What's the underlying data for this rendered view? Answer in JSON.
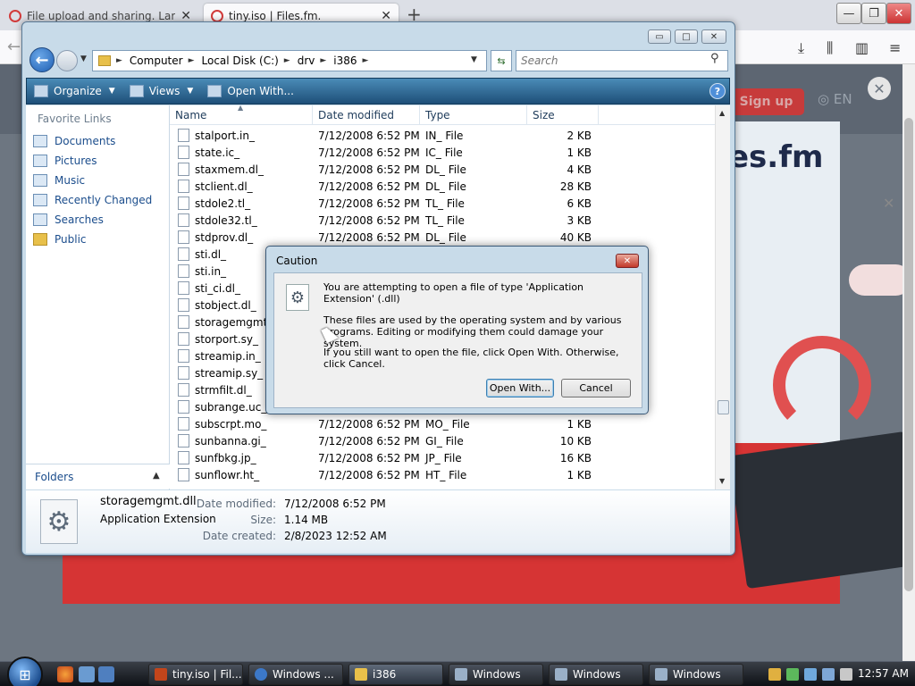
{
  "browser": {
    "tabs": [
      {
        "label": "File upload and sharing. Large"
      },
      {
        "label": "tiny.iso | Files.fm."
      }
    ],
    "new_tab": "+",
    "controls": {
      "minimize": "—",
      "maximize": "❐",
      "close": "✕"
    }
  },
  "page": {
    "signup": "Sign up",
    "lang": "EN",
    "logo_text": "es.fm",
    "modal_close": "✕"
  },
  "explorer": {
    "address": {
      "crumbs": [
        "Computer",
        "Local Disk (C:)",
        "drv",
        "i386"
      ]
    },
    "search_placeholder": "Search",
    "toolbar": {
      "organize": "Organize",
      "views": "Views",
      "open_with": "Open With...",
      "help": "?"
    },
    "favorites_title": "Favorite Links",
    "favorites": [
      "Documents",
      "Pictures",
      "Music",
      "Recently Changed",
      "Searches",
      "Public"
    ],
    "folders_label": "Folders",
    "columns": [
      "Name",
      "Date modified",
      "Type",
      "Size"
    ],
    "files": [
      {
        "name": "stalport.in_",
        "date": "7/12/2008 6:52 PM",
        "type": "IN_ File",
        "size": "2 KB"
      },
      {
        "name": "state.ic_",
        "date": "7/12/2008 6:52 PM",
        "type": "IC_ File",
        "size": "1 KB"
      },
      {
        "name": "staxmem.dl_",
        "date": "7/12/2008 6:52 PM",
        "type": "DL_ File",
        "size": "4 KB"
      },
      {
        "name": "stclient.dl_",
        "date": "7/12/2008 6:52 PM",
        "type": "DL_ File",
        "size": "28 KB"
      },
      {
        "name": "stdole2.tl_",
        "date": "7/12/2008 6:52 PM",
        "type": "TL_ File",
        "size": "6 KB"
      },
      {
        "name": "stdole32.tl_",
        "date": "7/12/2008 6:52 PM",
        "type": "TL_ File",
        "size": "3 KB"
      },
      {
        "name": "stdprov.dl_",
        "date": "7/12/2008 6:52 PM",
        "type": "DL_ File",
        "size": "40 KB"
      },
      {
        "name": "sti.dl_",
        "date": "",
        "type": "",
        "size": ""
      },
      {
        "name": "sti.in_",
        "date": "",
        "type": "",
        "size": ""
      },
      {
        "name": "sti_ci.dl_",
        "date": "",
        "type": "",
        "size": ""
      },
      {
        "name": "stobject.dl_",
        "date": "",
        "type": "",
        "size": ""
      },
      {
        "name": "storagemgmt.d",
        "date": "",
        "type": "",
        "size": ""
      },
      {
        "name": "storport.sy_",
        "date": "",
        "type": "",
        "size": ""
      },
      {
        "name": "streamip.in_",
        "date": "",
        "type": "",
        "size": ""
      },
      {
        "name": "streamip.sy_",
        "date": "",
        "type": "",
        "size": ""
      },
      {
        "name": "strmfilt.dl_",
        "date": "",
        "type": "",
        "size": ""
      },
      {
        "name": "subrange.uc_",
        "date": "",
        "type": "",
        "size": ""
      },
      {
        "name": "subscrpt.mo_",
        "date": "7/12/2008 6:52 PM",
        "type": "MO_ File",
        "size": "1 KB"
      },
      {
        "name": "sunbanna.gi_",
        "date": "7/12/2008 6:52 PM",
        "type": "GI_ File",
        "size": "10 KB"
      },
      {
        "name": "sunfbkg.jp_",
        "date": "7/12/2008 6:52 PM",
        "type": "JP_ File",
        "size": "16 KB"
      },
      {
        "name": "sunflowr.ht_",
        "date": "7/12/2008 6:52 PM",
        "type": "HT_ File",
        "size": "1 KB"
      }
    ],
    "details": {
      "name": "storagemgmt.dll",
      "type": "Application Extension",
      "date_modified_label": "Date modified:",
      "date_modified": "7/12/2008 6:52 PM",
      "size_label": "Size:",
      "size": "1.14 MB",
      "date_created_label": "Date created:",
      "date_created": "2/8/2023 12:52 AM"
    }
  },
  "dialog": {
    "title": "Caution",
    "line1": "You are attempting to open a file of type 'Application Extension' (.dll)",
    "line2": "These files are used by the operating system and by various programs. Editing or modifying them could damage your system.",
    "line3": "If you still want to open the file, click Open With. Otherwise, click Cancel.",
    "open_with": "Open With...",
    "cancel": "Cancel"
  },
  "taskbar": {
    "tasks": [
      {
        "label": "tiny.iso | Fil..."
      },
      {
        "label": "Windows ..."
      },
      {
        "label": "i386"
      },
      {
        "label": "Windows"
      },
      {
        "label": "Windows"
      },
      {
        "label": "Windows"
      }
    ],
    "clock": "12:57 AM"
  }
}
